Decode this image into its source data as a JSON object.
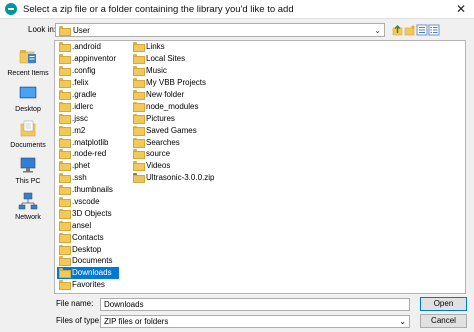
{
  "window": {
    "title": "Select a zip file or a folder containing the library you'd like to add",
    "close_glyph": "✕"
  },
  "lookin": {
    "label": "Look in:",
    "value": "User"
  },
  "places": [
    {
      "label": "Recent Items",
      "icon": "recent-items-icon"
    },
    {
      "label": "Desktop",
      "icon": "desktop-icon"
    },
    {
      "label": "Documents",
      "icon": "documents-icon"
    },
    {
      "label": "This PC",
      "icon": "this-pc-icon"
    },
    {
      "label": "Network",
      "icon": "network-icon"
    }
  ],
  "files_col1": [
    ".android",
    ".appinventor",
    ".config",
    ".felix",
    ".gradle",
    ".idlerc",
    ".jssc",
    ".m2",
    ".matplotlib",
    ".node-red",
    ".phet",
    ".ssh",
    ".thumbnails",
    ".vscode",
    "3D Objects",
    "ansel",
    "Contacts",
    "Desktop",
    "Documents",
    "Downloads",
    "Favorites"
  ],
  "files_col2": [
    "Links",
    "Local Sites",
    "Music",
    "My VBB Projects",
    "New folder",
    "node_modules",
    "Pictures",
    "Saved Games",
    "Searches",
    "source",
    "Videos",
    "Ultrasonic-3.0.0.zip"
  ],
  "selected_file": "Downloads",
  "filename": {
    "label": "File name:",
    "value": "Downloads"
  },
  "filetype": {
    "label": "Files of type:",
    "value": "ZIP files or folders"
  },
  "buttons": {
    "open": "Open",
    "cancel": "Cancel"
  },
  "colors": {
    "selection": "#0078d7",
    "folder": "#f3c85a",
    "accent": "#00979c"
  }
}
